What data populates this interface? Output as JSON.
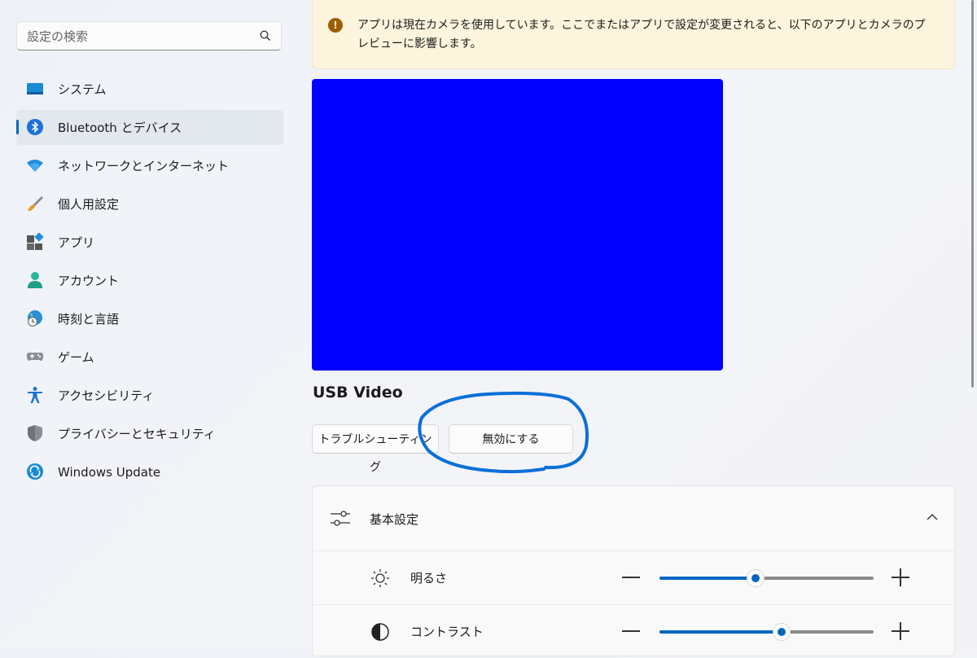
{
  "search": {
    "placeholder": "設定の検索",
    "icon": "search-icon"
  },
  "sidebar": {
    "items": [
      {
        "label": "システム",
        "icon": "system-monitor-icon",
        "active": false
      },
      {
        "label": "Bluetooth とデバイス",
        "icon": "bluetooth-icon",
        "active": true
      },
      {
        "label": "ネットワークとインターネット",
        "icon": "wifi-icon",
        "active": false
      },
      {
        "label": "個人用設定",
        "icon": "paintbrush-icon",
        "active": false
      },
      {
        "label": "アプリ",
        "icon": "apps-icon",
        "active": false
      },
      {
        "label": "アカウント",
        "icon": "account-icon",
        "active": false
      },
      {
        "label": "時刻と言語",
        "icon": "globe-clock-icon",
        "active": false
      },
      {
        "label": "ゲーム",
        "icon": "gamepad-icon",
        "active": false
      },
      {
        "label": "アクセシビリティ",
        "icon": "accessibility-icon",
        "active": false
      },
      {
        "label": "プライバシーとセキュリティ",
        "icon": "shield-icon",
        "active": false
      },
      {
        "label": "Windows Update",
        "icon": "windows-update-icon",
        "active": false
      }
    ]
  },
  "banner": {
    "icon": "warning-icon",
    "text": "アプリは現在カメラを使用しています。ここでまたはアプリで設定が変更されると、以下のアプリとカメラのプレビューに影響します。"
  },
  "camera": {
    "preview_color": "#0000ff",
    "name": "USB Video",
    "troubleshoot_label": "トラブルシューティング",
    "disable_label": "無効にする"
  },
  "basic_settings": {
    "title": "基本設定",
    "icon": "sliders-icon",
    "expanded": true,
    "rows": [
      {
        "label": "明るさ",
        "icon": "brightness-icon",
        "value_fraction": 0.45
      },
      {
        "label": "コントラスト",
        "icon": "contrast-icon",
        "value_fraction": 0.57
      }
    ]
  },
  "colors": {
    "accent": "#0067c0",
    "highlight_circle": "#0a6fd8",
    "warning": "#9d5d00"
  }
}
